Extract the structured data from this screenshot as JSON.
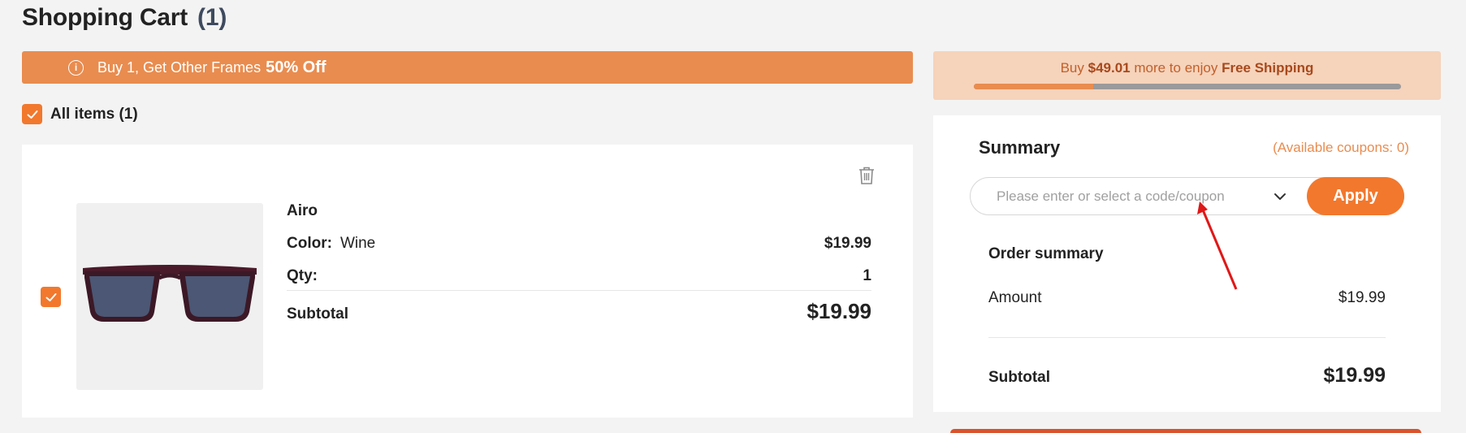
{
  "header": {
    "title": "Shopping Cart",
    "count": "(1)"
  },
  "promo": {
    "text": "Buy 1, Get Other Frames",
    "highlight": "50% Off"
  },
  "select_all": {
    "label": "All items (1)",
    "checked": true
  },
  "cart_item": {
    "checked": true,
    "name": "Airo",
    "color_label": "Color:",
    "color_value": "Wine",
    "price": "$19.99",
    "qty_label": "Qty:",
    "qty_value": "1",
    "subtotal_label": "Subtotal",
    "subtotal_value": "$19.99"
  },
  "shipping": {
    "prefix": "Buy",
    "amount": "$49.01",
    "middle": "more to enjoy",
    "free": "Free Shipping",
    "progress_fraction": 0.28
  },
  "summary": {
    "title": "Summary",
    "coupons": "(Available coupons: 0)",
    "coupon_placeholder": "Please enter or select a code/coupon",
    "apply_label": "Apply",
    "order_title": "Order summary",
    "amount_label": "Amount",
    "amount_value": "$19.99",
    "subtotal_label": "Subtotal",
    "subtotal_value": "$19.99"
  },
  "colors": {
    "accent": "#f2782d",
    "promo_bg": "#e98c4f",
    "shipping_bg": "#f6d3bb",
    "annotation_arrow": "#e01818"
  },
  "icons": [
    "info-icon",
    "check-icon",
    "trash-icon",
    "chevron-down-icon",
    "annotation-arrow"
  ]
}
